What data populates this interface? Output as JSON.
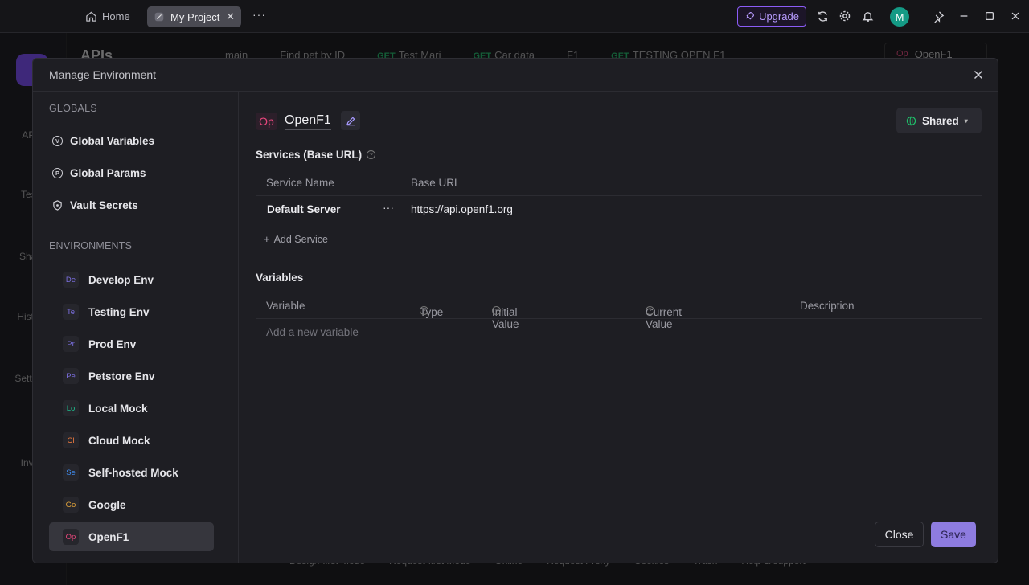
{
  "titlebar": {
    "home_label": "Home",
    "tab_label": "My Project",
    "more": "···",
    "upgrade_label": "Upgrade",
    "avatar_initial": "M",
    "accent": "#8b5cf6"
  },
  "background": {
    "title": "APIs",
    "branch": "main",
    "tabs": [
      {
        "method": "",
        "label": "Find pet by ID"
      },
      {
        "method": "GET",
        "label": "Test Mari"
      },
      {
        "method": "GET",
        "label": "Car data"
      },
      {
        "method": "",
        "label": "F1"
      },
      {
        "method": "GET",
        "label": "TESTING OPEN F1"
      }
    ],
    "env_selector": "OpenF1",
    "sidebar": [
      "APIs",
      "Tests",
      "Share",
      "History",
      "Settings",
      "Invite"
    ],
    "footer": [
      "Design-first Mode",
      "Request-first Mode",
      "Online",
      "Request Proxy",
      "Cookies",
      "Trash",
      "Help & support"
    ]
  },
  "modal": {
    "title": "Manage Environment",
    "globals_label": "GLOBALS",
    "globals": [
      {
        "icon": "V",
        "label": "Global Variables"
      },
      {
        "icon": "P",
        "label": "Global Params"
      },
      {
        "icon": "vault",
        "label": "Vault Secrets"
      }
    ],
    "environments_label": "ENVIRONMENTS",
    "environments": [
      {
        "abbr": "De",
        "label": "Develop Env",
        "color": "#7b6fe0"
      },
      {
        "abbr": "Te",
        "label": "Testing Env",
        "color": "#7b6fe0"
      },
      {
        "abbr": "Pr",
        "label": "Prod Env",
        "color": "#7b6fe0"
      },
      {
        "abbr": "Pe",
        "label": "Petstore Env",
        "color": "#7b6fe0"
      },
      {
        "abbr": "Lo",
        "label": "Local Mock",
        "color": "#1fbf8f"
      },
      {
        "abbr": "Cl",
        "label": "Cloud Mock",
        "color": "#f07b3f"
      },
      {
        "abbr": "Se",
        "label": "Self-hosted Mock",
        "color": "#3f8cf0"
      },
      {
        "abbr": "Go",
        "label": "Google",
        "color": "#e0a23a"
      },
      {
        "abbr": "Op",
        "label": "OpenF1",
        "color": "#e8477d"
      }
    ],
    "selected_env": {
      "abbr": "Op",
      "name": "OpenF1",
      "visibility": "Shared"
    },
    "services": {
      "title": "Services (Base URL)",
      "headers": [
        "Service Name",
        "Base URL"
      ],
      "rows": [
        {
          "name": "Default Server",
          "url": "https://api.openf1.org"
        }
      ],
      "add_label": "Add Service"
    },
    "variables": {
      "title": "Variables",
      "headers": [
        "Variable",
        "Type",
        "Initial Value",
        "Current Value",
        "Description"
      ],
      "placeholder": "Add a new variable"
    },
    "close_label": "Close",
    "save_label": "Save"
  }
}
